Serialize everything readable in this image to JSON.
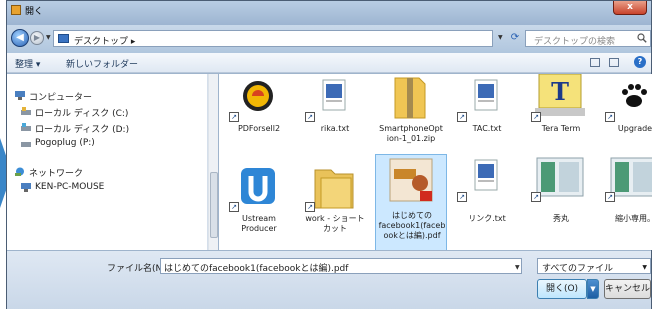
{
  "window": {
    "title": "開く",
    "close_label": "x"
  },
  "address": {
    "path": "デスクトップ ▸",
    "search_placeholder": "デスクトップの検索"
  },
  "toolbar": {
    "organize": "整理 ▾",
    "new_folder": "新しいフォルダー"
  },
  "nav": {
    "items": [
      {
        "label": "コンピューター",
        "icon": "computer-icon"
      },
      {
        "label": "ローカル ディスク (C:)",
        "icon": "drive-icon"
      },
      {
        "label": "ローカル ディスク (D:)",
        "icon": "drive-icon"
      },
      {
        "label": "Pogoplug (P:)",
        "icon": "drive-icon"
      },
      {
        "label": "ネットワーク",
        "icon": "network-icon"
      },
      {
        "label": "KEN-PC-MOUSE",
        "icon": "computer-icon"
      }
    ]
  },
  "files": {
    "row1": [
      {
        "name": "PDForsell2",
        "icon": "app-icon"
      },
      {
        "name": "rika.txt",
        "icon": "text-file-icon"
      },
      {
        "name": "SmartphoneOption-1_01.zip",
        "line1": "SmartphoneOpt",
        "line2": "ion-1_01.zip",
        "icon": "zip-folder-icon"
      },
      {
        "name": "TAC.txt",
        "icon": "text-file-icon"
      },
      {
        "name": "Tera Term",
        "icon": "app-icon"
      },
      {
        "name": "Upgrade",
        "icon": "app-icon"
      }
    ],
    "row2": [
      {
        "line1": "Ustream",
        "line2": "Producer",
        "icon": "app-icon"
      },
      {
        "line1": "work - ショート",
        "line2": "カット",
        "icon": "folder-icon"
      },
      {
        "line1": "はじめての",
        "line2": "facebook1(faceb",
        "line3": "ookとは編).pdf",
        "icon": "pdf-file-icon"
      },
      {
        "line1": "リンク.txt",
        "icon": "text-file-icon"
      },
      {
        "line1": "秀丸",
        "icon": "app-icon"
      },
      {
        "line1": "縮小専用。",
        "icon": "app-icon"
      }
    ]
  },
  "bottom": {
    "filename_label": "ファイル名(N):",
    "filename_value": "はじめてのfacebook1(facebookとは編).pdf",
    "filetype_value": "すべてのファイル",
    "open_label": "開く(O)",
    "cancel_label": "キャンセル"
  }
}
